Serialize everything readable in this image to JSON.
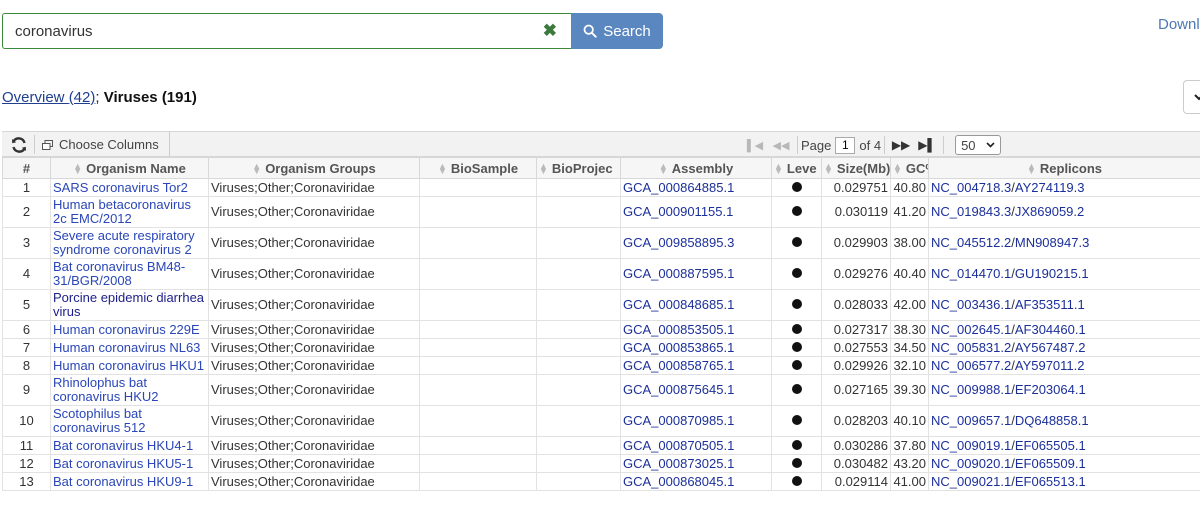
{
  "search": {
    "value": "coronavirus",
    "button_label": "Search"
  },
  "header": {
    "download_label": "Downl"
  },
  "tabs": {
    "overview_label": "Overview",
    "overview_count": "(42)",
    "separator": ";",
    "viruses_label": "Viruses (191)"
  },
  "toolbar": {
    "choose_columns_label": "Choose Columns",
    "page_label": "Page",
    "page_value": "1",
    "of_label": "of 4",
    "rows_per_page": "50"
  },
  "columns": [
    "#",
    "Organism Name",
    "Organism Groups",
    "BioSample",
    "BioProjec",
    "Assembly",
    "Leve",
    "Size(Mb)",
    "GC%",
    "Replicons"
  ],
  "rows": [
    {
      "n": "1",
      "name": "SARS coronavirus Tor2",
      "group": "Viruses;Other;Coronaviridae",
      "biosample": "",
      "bioproject": "",
      "assembly": "GCA_000864885.1",
      "size": "0.029751",
      "gc": "40.80",
      "rep1": "NC_004718.3",
      "rep2": "AY274119.3"
    },
    {
      "n": "2",
      "name": "Human betacoronavirus 2c EMC/2012",
      "group": "Viruses;Other;Coronaviridae",
      "biosample": "",
      "bioproject": "",
      "assembly": "GCA_000901155.1",
      "size": "0.030119",
      "gc": "41.20",
      "rep1": "NC_019843.3",
      "rep2": "JX869059.2"
    },
    {
      "n": "3",
      "name": "Severe acute respiratory syndrome coronavirus 2",
      "group": "Viruses;Other;Coronaviridae",
      "biosample": "",
      "bioproject": "",
      "assembly": "GCA_009858895.3",
      "size": "0.029903",
      "gc": "38.00",
      "rep1": "NC_045512.2",
      "rep2": "MN908947.3"
    },
    {
      "n": "4",
      "name": "Bat coronavirus BM48-31/BGR/2008",
      "group": "Viruses;Other;Coronaviridae",
      "biosample": "",
      "bioproject": "",
      "assembly": "GCA_000887595.1",
      "size": "0.029276",
      "gc": "40.40",
      "rep1": "NC_014470.1",
      "rep2": "GU190215.1"
    },
    {
      "n": "5",
      "name": "Porcine epidemic diarrhea virus",
      "group": "Viruses;Other;Coronaviridae",
      "biosample": "",
      "bioproject": "",
      "assembly": "GCA_000848685.1",
      "size": "0.028033",
      "gc": "42.00",
      "rep1": "NC_003436.1",
      "rep2": "AF353511.1"
    },
    {
      "n": "6",
      "name": "Human coronavirus 229E",
      "group": "Viruses;Other;Coronaviridae",
      "biosample": "",
      "bioproject": "",
      "assembly": "GCA_000853505.1",
      "size": "0.027317",
      "gc": "38.30",
      "rep1": "NC_002645.1",
      "rep2": "AF304460.1"
    },
    {
      "n": "7",
      "name": "Human coronavirus NL63",
      "group": "Viruses;Other;Coronaviridae",
      "biosample": "",
      "bioproject": "",
      "assembly": "GCA_000853865.1",
      "size": "0.027553",
      "gc": "34.50",
      "rep1": "NC_005831.2",
      "rep2": "AY567487.2"
    },
    {
      "n": "8",
      "name": "Human coronavirus HKU1",
      "group": "Viruses;Other;Coronaviridae",
      "biosample": "",
      "bioproject": "",
      "assembly": "GCA_000858765.1",
      "size": "0.029926",
      "gc": "32.10",
      "rep1": "NC_006577.2",
      "rep2": "AY597011.2"
    },
    {
      "n": "9",
      "name": "Rhinolophus bat coronavirus HKU2",
      "group": "Viruses;Other;Coronaviridae",
      "biosample": "",
      "bioproject": "",
      "assembly": "GCA_000875645.1",
      "size": "0.027165",
      "gc": "39.30",
      "rep1": "NC_009988.1",
      "rep2": "EF203064.1"
    },
    {
      "n": "10",
      "name": "Scotophilus bat coronavirus 512",
      "group": "Viruses;Other;Coronaviridae",
      "biosample": "",
      "bioproject": "",
      "assembly": "GCA_000870985.1",
      "size": "0.028203",
      "gc": "40.10",
      "rep1": "NC_009657.1",
      "rep2": "DQ648858.1"
    },
    {
      "n": "11",
      "name": "Bat coronavirus HKU4-1",
      "group": "Viruses;Other;Coronaviridae",
      "biosample": "",
      "bioproject": "",
      "assembly": "GCA_000870505.1",
      "size": "0.030286",
      "gc": "37.80",
      "rep1": "NC_009019.1",
      "rep2": "EF065505.1"
    },
    {
      "n": "12",
      "name": "Bat coronavirus HKU5-1",
      "group": "Viruses;Other;Coronaviridae",
      "biosample": "",
      "bioproject": "",
      "assembly": "GCA_000873025.1",
      "size": "0.030482",
      "gc": "43.20",
      "rep1": "NC_009020.1",
      "rep2": "EF065509.1"
    },
    {
      "n": "13",
      "name": "Bat coronavirus HKU9-1",
      "group": "Viruses;Other;Coronaviridae",
      "biosample": "",
      "bioproject": "",
      "assembly": "GCA_000868045.1",
      "size": "0.029114",
      "gc": "41.00",
      "rep1": "NC_009021.1",
      "rep2": "EF065513.1"
    }
  ],
  "icons": {
    "clear": "close-icon",
    "search": "search-icon",
    "refresh": "refresh-icon",
    "columns": "columns-icon",
    "level": "level-dot-icon"
  },
  "colors": {
    "search_button": "#5b87c0",
    "search_border": "#3b8a3b",
    "link": "#1b2f9a",
    "organism_link": "#2a46b8"
  }
}
